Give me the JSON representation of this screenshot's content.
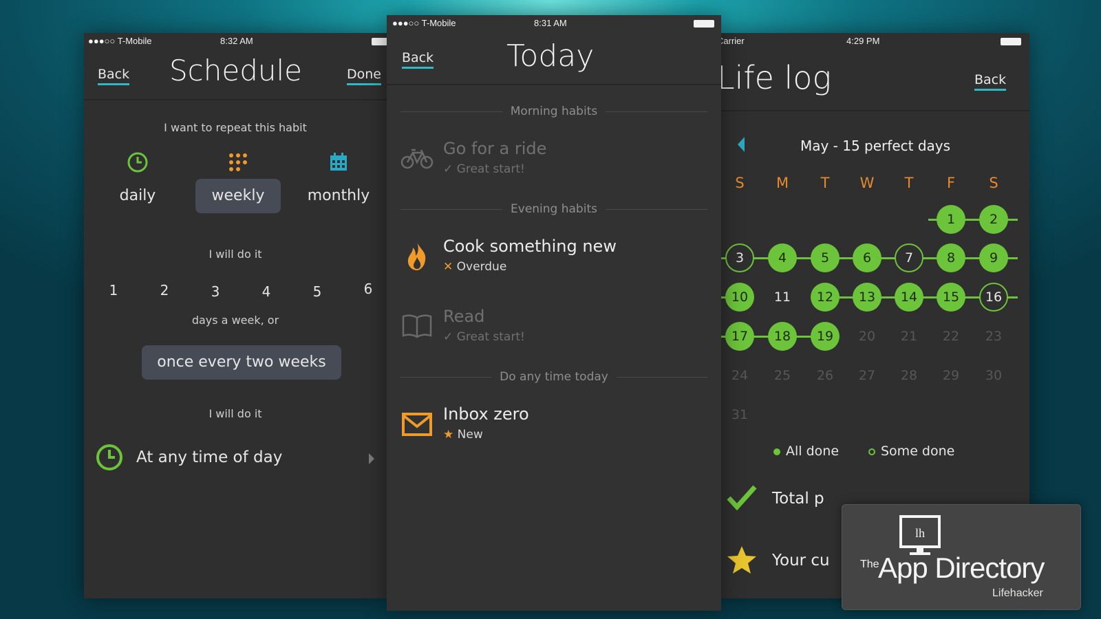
{
  "schedule_screen": {
    "status": {
      "carrier": "●●●○○ T-Mobile",
      "time": "8:32 AM"
    },
    "back_label": "Back",
    "title": "Schedule",
    "done_label": "Done",
    "repeat_label": "I want to repeat this habit",
    "frequency_options": [
      {
        "label": "daily",
        "icon": "clock-icon",
        "selected": false
      },
      {
        "label": "weekly",
        "icon": "dots-grid-icon",
        "selected": true
      },
      {
        "label": "monthly",
        "icon": "calendar-icon",
        "selected": false
      }
    ],
    "will_do_label": "I will do it",
    "day_counts": [
      "1",
      "2",
      "3",
      "4",
      "5",
      "6"
    ],
    "days_label": "days a week, or",
    "interval_option": "once every two weeks",
    "time_section_label": "I will do it",
    "time_row_label": "At any time of day",
    "colors": {
      "accent": "#34b8c4",
      "green": "#6cc43a",
      "orange": "#f09a2a",
      "teal": "#2aa9c4"
    }
  },
  "today_screen": {
    "status": {
      "carrier": "●●●○○ T-Mobile",
      "time": "8:31 AM"
    },
    "back_label": "Back",
    "title": "Today",
    "sections": [
      {
        "header": "Morning habits",
        "habits": [
          {
            "name": "Go for a ride",
            "status": "Great start!",
            "status_icon": "check-icon",
            "icon": "bicycle-icon",
            "dim": true
          }
        ]
      },
      {
        "header": "Evening habits",
        "habits": [
          {
            "name": "Cook something new",
            "status": "Overdue",
            "status_icon": "x-icon",
            "icon": "flame-icon",
            "dim": false
          },
          {
            "name": "Read",
            "status": "Great start!",
            "status_icon": "check-icon",
            "icon": "book-icon",
            "dim": true
          }
        ]
      },
      {
        "header": "Do any time today",
        "habits": [
          {
            "name": "Inbox zero",
            "status": "New",
            "status_icon": "star-icon",
            "icon": "envelope-icon",
            "dim": false
          }
        ]
      }
    ]
  },
  "lifelog_screen": {
    "status": {
      "carrier": "Carrier",
      "time": "4:29 PM"
    },
    "title": "Life log",
    "back_label": "Back",
    "month_label": "May - 15 perfect days",
    "weekdays": [
      "S",
      "M",
      "T",
      "W",
      "T",
      "F",
      "S"
    ],
    "days": [
      {
        "d": "1",
        "s": "full"
      },
      {
        "d": "2",
        "s": "full"
      },
      {
        "d": "3",
        "s": "partial"
      },
      {
        "d": "4",
        "s": "full"
      },
      {
        "d": "5",
        "s": "full"
      },
      {
        "d": "6",
        "s": "full"
      },
      {
        "d": "7",
        "s": "partial"
      },
      {
        "d": "8",
        "s": "full"
      },
      {
        "d": "9",
        "s": "full"
      },
      {
        "d": "10",
        "s": "full"
      },
      {
        "d": "11",
        "s": "none"
      },
      {
        "d": "12",
        "s": "full"
      },
      {
        "d": "13",
        "s": "full"
      },
      {
        "d": "14",
        "s": "full"
      },
      {
        "d": "15",
        "s": "full"
      },
      {
        "d": "16",
        "s": "partial"
      },
      {
        "d": "17",
        "s": "full"
      },
      {
        "d": "18",
        "s": "full"
      },
      {
        "d": "19",
        "s": "full"
      },
      {
        "d": "20",
        "s": "future"
      },
      {
        "d": "21",
        "s": "future"
      },
      {
        "d": "22",
        "s": "future"
      },
      {
        "d": "23",
        "s": "future"
      },
      {
        "d": "24",
        "s": "future"
      },
      {
        "d": "25",
        "s": "future"
      },
      {
        "d": "26",
        "s": "future"
      },
      {
        "d": "27",
        "s": "future"
      },
      {
        "d": "28",
        "s": "future"
      },
      {
        "d": "29",
        "s": "future"
      },
      {
        "d": "30",
        "s": "future"
      },
      {
        "d": "31",
        "s": "future"
      }
    ],
    "legend_all": "All done",
    "legend_some": "Some done",
    "stat_total": "Total p",
    "stat_current": "Your cu"
  },
  "badge": {
    "logo_text": "lh",
    "the": "The",
    "name": "App Directory",
    "brand": "Lifehacker"
  }
}
